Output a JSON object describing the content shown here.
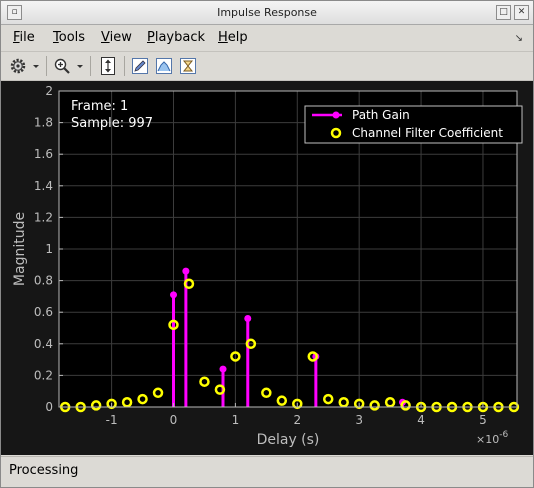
{
  "window": {
    "title": "Impulse Response"
  },
  "menubar": {
    "items": [
      {
        "mnemonic": "F",
        "rest": "ile"
      },
      {
        "mnemonic": "T",
        "rest": "ools"
      },
      {
        "mnemonic": "V",
        "rest": "iew"
      },
      {
        "mnemonic": "P",
        "rest": "layback"
      },
      {
        "mnemonic": "H",
        "rest": "elp"
      }
    ]
  },
  "toolbar": {
    "icons": [
      "settings-icon",
      "dropdown-arrow-icon",
      "zoom-in-icon",
      "dropdown-arrow-icon",
      "scale-axes-icon",
      "edit-icon",
      "chart-icon",
      "hourglass-icon"
    ]
  },
  "plot": {
    "frame_label": "Frame: 1",
    "sample_label": "Sample: 997",
    "background": "#000000",
    "grid_color": "#3c3c3c",
    "path_gain_color": "#ff00ff",
    "coefficient_color": "#ffff00"
  },
  "status": {
    "text": "Processing"
  },
  "chart_data": {
    "type": "scatter",
    "xlabel": "Delay (s)",
    "ylabel": "Magnitude",
    "x_exponent_label": "×10",
    "x_exponent_power": "-6",
    "xlim": [
      -1.85,
      5.55
    ],
    "ylim": [
      0,
      2
    ],
    "xticks": [
      -1,
      0,
      1,
      2,
      3,
      4,
      5
    ],
    "yticks": [
      0,
      0.2,
      0.4,
      0.6,
      0.8,
      1,
      1.2,
      1.4,
      1.6,
      1.8,
      2
    ],
    "xtick_labels": [
      "-1",
      "0",
      "1",
      "2",
      "3",
      "4",
      "5"
    ],
    "ytick_labels": [
      "0",
      "0.2",
      "0.4",
      "0.6",
      "0.8",
      "1",
      "1.2",
      "1.4",
      "1.6",
      "1.8",
      "2"
    ],
    "grid": true,
    "legend_position": "top-right",
    "series": [
      {
        "name": "Path Gain",
        "style": "stem",
        "x": [
          0.0,
          0.2,
          0.8,
          1.2,
          2.3,
          3.7
        ],
        "y": [
          0.71,
          0.86,
          0.24,
          0.56,
          0.32,
          0.03
        ]
      },
      {
        "name": "Channel Filter Coefficient",
        "style": "markers",
        "x": [
          -1.75,
          -1.5,
          -1.25,
          -1.0,
          -0.75,
          -0.5,
          -0.25,
          0.0,
          0.25,
          0.5,
          0.75,
          1.0,
          1.25,
          1.5,
          1.75,
          2.0,
          2.25,
          2.5,
          2.75,
          3.0,
          3.25,
          3.5,
          3.75,
          4.0,
          4.25,
          4.5,
          4.75,
          5.0,
          5.25,
          5.5
        ],
        "y": [
          0.0,
          0.0,
          0.01,
          0.02,
          0.03,
          0.05,
          0.09,
          0.52,
          0.78,
          0.16,
          0.11,
          0.32,
          0.4,
          0.09,
          0.04,
          0.02,
          0.32,
          0.05,
          0.03,
          0.02,
          0.01,
          0.03,
          0.01,
          0.0,
          0.0,
          0.0,
          0.0,
          0.0,
          0.0,
          0.0
        ]
      }
    ]
  }
}
